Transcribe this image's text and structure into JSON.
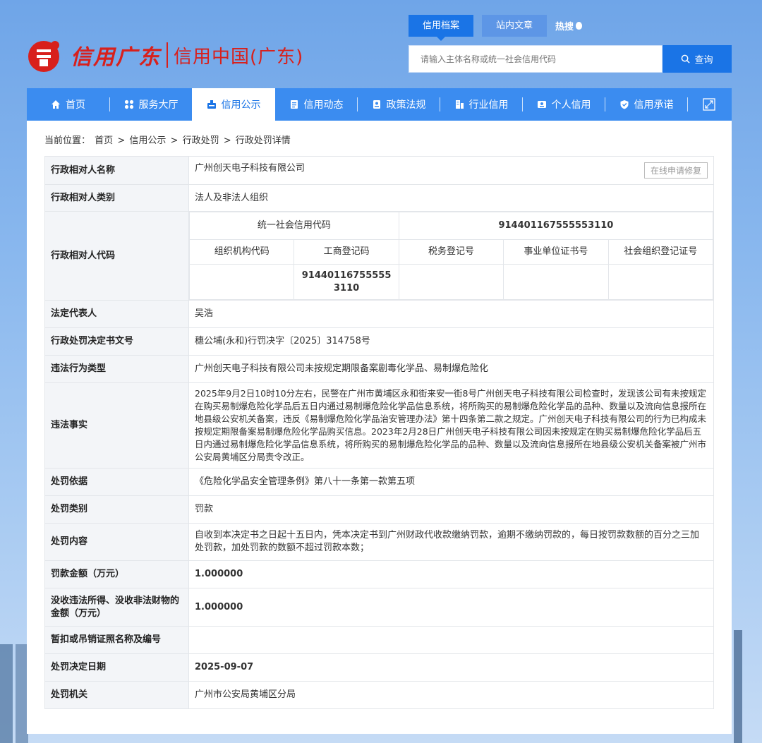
{
  "header": {
    "logo_text_1": "信用广东",
    "logo_text_2": "信用中国(广东)",
    "search_tabs": [
      "信用档案",
      "站内文章"
    ],
    "hot_label": "热搜",
    "search_placeholder": "请输入主体名称或统一社会信用代码",
    "search_button": "查询"
  },
  "nav": {
    "items": [
      {
        "label": "首页",
        "icon": "home-icon"
      },
      {
        "label": "服务大厅",
        "icon": "grid-icon"
      },
      {
        "label": "信用公示",
        "icon": "badge-icon"
      },
      {
        "label": "信用动态",
        "icon": "document-icon"
      },
      {
        "label": "政策法规",
        "icon": "law-icon"
      },
      {
        "label": "行业信用",
        "icon": "building-icon"
      },
      {
        "label": "个人信用",
        "icon": "id-card-icon"
      },
      {
        "label": "信用承诺",
        "icon": "shield-icon"
      }
    ],
    "active_index": 2
  },
  "breadcrumb": {
    "prefix": "当前位置：",
    "items": [
      "首页",
      "信用公示",
      "行政处罚",
      "行政处罚详情"
    ],
    "sep": ">"
  },
  "detail": {
    "repair_button": "在线申请修复",
    "rows": {
      "name": {
        "label": "行政相对人名称",
        "value": "广州创天电子科技有限公司"
      },
      "type": {
        "label": "行政相对人类别",
        "value": "法人及非法人组织"
      },
      "code": {
        "label": "行政相对人代码",
        "uscc_label": "统一社会信用代码",
        "uscc_value": "914401167555553110",
        "sub_headers": [
          "组织机构代码",
          "工商登记码",
          "税务登记号",
          "事业单位证书号",
          "社会组织登记证号"
        ],
        "sub_values": [
          "",
          "914401167555553110",
          "",
          "",
          ""
        ]
      },
      "legal_rep": {
        "label": "法定代表人",
        "value": "吴浩"
      },
      "doc_no": {
        "label": "行政处罚决定书文号",
        "value": "穗公埔(永和)行罚决字〔2025〕314758号"
      },
      "violation_type": {
        "label": "违法行为类型",
        "value": "广州创天电子科技有限公司未按规定期限备案剧毒化学品、易制爆危险化"
      },
      "facts": {
        "label": "违法事实",
        "value": "2025年9月2日10时10分左右，民警在广州市黄埔区永和街来安一街8号广州创天电子科技有限公司检查时，发现该公司有未按规定在购买易制爆危险化学品后五日内通过易制爆危险化学品信息系统，将所购买的易制爆危险化学品的品种、数量以及流向信息报所在地县级公安机关备案，违反《易制爆危险化学品治安管理办法》第十四条第二款之规定。广州创天电子科技有限公司的行为已构成未按规定期限备案易制爆危险化学品购买信息。2023年2月28日广州创天电子科技有限公司因未按规定在购买易制爆危险化学品后五日内通过易制爆危险化学品信息系统，将所购买的易制爆危险化学品的品种、数量以及流向信息报所在地县级公安机关备案被广州市公安局黄埔区分局责令改正。"
      },
      "basis": {
        "label": "处罚依据",
        "value": "《危险化学品安全管理条例》第八十一条第一款第五项"
      },
      "category": {
        "label": "处罚类别",
        "value": "罚款"
      },
      "content": {
        "label": "处罚内容",
        "value": "自收到本决定书之日起十五日内，凭本决定书到广州财政代收款缴纳罚款，逾期不缴纳罚款的，每日按罚款数额的百分之三加处罚款，加处罚款的数额不超过罚款本数；"
      },
      "fine": {
        "label": "罚款金额（万元）",
        "value": "1.000000"
      },
      "confiscate": {
        "label": "没收违法所得、没收非法财物的金额（万元）",
        "value": "1.000000"
      },
      "license": {
        "label": "暂扣或吊销证照名称及编号",
        "value": ""
      },
      "date": {
        "label": "处罚决定日期",
        "value": "2025-09-07"
      },
      "authority": {
        "label": "处罚机关",
        "value": "广州市公安局黄埔区分局"
      }
    }
  },
  "colors": {
    "brand_red": "#d8201c",
    "nav_blue": "#3b8cf0",
    "accent_blue": "#1a74e6"
  }
}
